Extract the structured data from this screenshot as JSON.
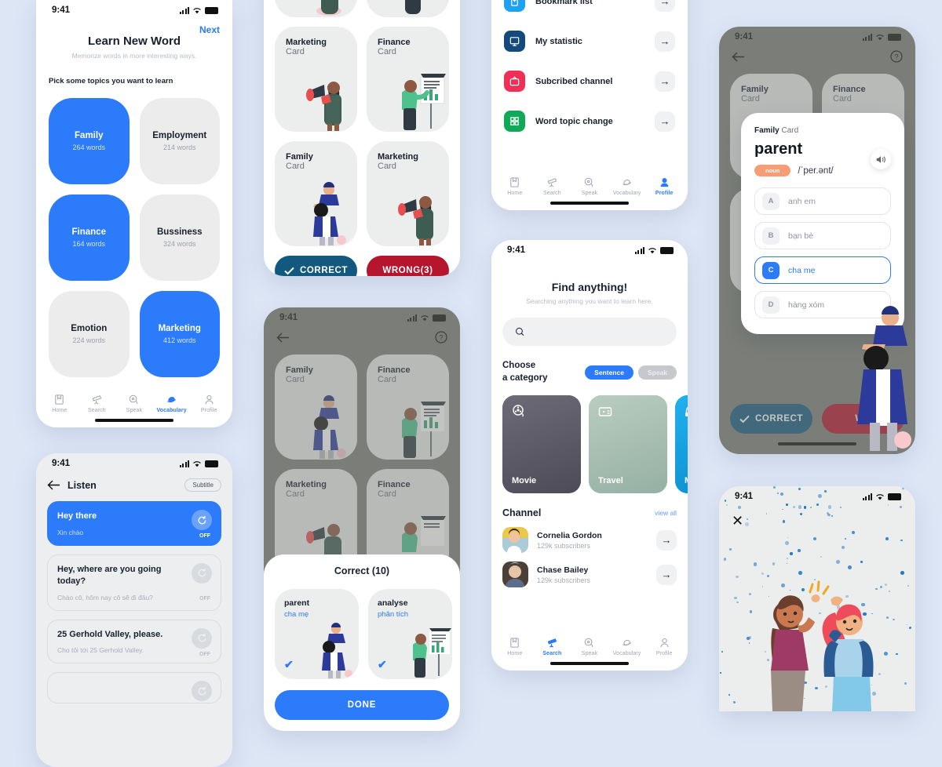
{
  "status_bar": {
    "time": "9:41"
  },
  "tabbar": {
    "items": [
      {
        "label": "Home",
        "icon": "home-book-icon"
      },
      {
        "label": "Search",
        "icon": "telescope-icon"
      },
      {
        "label": "Speak",
        "icon": "speak-bubble-icon"
      },
      {
        "label": "Vocabulary",
        "icon": "saturn-icon"
      },
      {
        "label": "Profile",
        "icon": "person-icon"
      }
    ]
  },
  "learn_screen": {
    "next_label": "Next",
    "title": "Learn New Word",
    "subtitle": "Memorize words in more interesting ways.",
    "pick_label": "Pick some topics you want to learn",
    "topics": [
      {
        "name": "Family",
        "words": "264 words",
        "selected": true
      },
      {
        "name": "Employment",
        "words": "214 words",
        "selected": false
      },
      {
        "name": "Finance",
        "words": "164 words",
        "selected": true
      },
      {
        "name": "Bussiness",
        "words": "324 words",
        "selected": false
      },
      {
        "name": "Emotion",
        "words": "224 words",
        "selected": false
      },
      {
        "name": "Marketing",
        "words": "412 words",
        "selected": true
      }
    ],
    "active_tab": "Vocabulary"
  },
  "listen_screen": {
    "title": "Listen",
    "subtitle_button": "Subtitle",
    "off_label": "OFF",
    "items": [
      {
        "en": "Hey there",
        "vi": "Xin chào",
        "active": true
      },
      {
        "en": "Hey, where are you going today?",
        "vi": "Chào cô, hôm nay cô sẽ đi đâu?",
        "active": false
      },
      {
        "en": "25 Gerhold Valley, please.",
        "vi": "Cho tôi tới 25 Gerhold Valley.",
        "active": false
      }
    ]
  },
  "flashcard_screen": {
    "cards": [
      {
        "topic": "Marketing",
        "sub": "Card",
        "art": "megaphone-woman"
      },
      {
        "topic": "Finance",
        "sub": "Card",
        "art": "chart-man"
      },
      {
        "topic": "Family",
        "sub": "Card",
        "art": "parent-child"
      },
      {
        "topic": "Marketing",
        "sub": "Card",
        "art": "megaphone-woman"
      }
    ],
    "correct_label": "CORRECT",
    "wrong_label": "WRONG(3)"
  },
  "correct_modal_screen": {
    "sheet_title": "Correct (10)",
    "results": [
      {
        "word": "parent",
        "translation": "cha mẹ",
        "art": "parent-child"
      },
      {
        "word": "analyse",
        "translation": "phân tích",
        "art": "chart-man"
      }
    ],
    "done_label": "DONE",
    "bg_cards": [
      {
        "topic": "Family",
        "sub": "Card",
        "art": "parent-child"
      },
      {
        "topic": "Finance",
        "sub": "Card",
        "art": "chart-man"
      },
      {
        "topic": "Marketing",
        "sub": "Card",
        "art": "megaphone-woman"
      },
      {
        "topic": "Finance",
        "sub": "Card",
        "art": "chart-man"
      }
    ]
  },
  "profile_menu_screen": {
    "items": [
      {
        "label": "Bookmark list",
        "icon": "bookmark-icon",
        "color": "#1da1f2"
      },
      {
        "label": "My statistic",
        "icon": "chart-icon",
        "color": "#134a7c"
      },
      {
        "label": "Subcribed channel",
        "icon": "tv-icon",
        "color": "#ef3054"
      },
      {
        "label": "Word topic change",
        "icon": "grid-icon",
        "color": "#0fa958"
      }
    ],
    "active_tab": "Profile"
  },
  "search_screen": {
    "title": "Find anything!",
    "subtitle": "Searching anything you want to learn here.",
    "search_placeholder": "",
    "choose_label_line1": "Choose",
    "choose_label_line2": "a category",
    "pills": [
      {
        "label": "Sentence",
        "active": true
      },
      {
        "label": "Speak",
        "active": false
      }
    ],
    "categories": [
      {
        "name": "Movie",
        "icon": "film-reel-icon",
        "color": "#5b5a66"
      },
      {
        "name": "Travel",
        "icon": "ticket-icon",
        "color": "#a6bfb0"
      },
      {
        "name": "Mu",
        "icon": "headphone-icon",
        "color": "#0b9fe3"
      }
    ],
    "channel_heading": "Channel",
    "view_all_label": "view all",
    "channels": [
      {
        "name": "Cornelia Gordon",
        "subs": "129k subscribers",
        "avatar": "woman-avatar"
      },
      {
        "name": "Chase Bailey",
        "subs": "129k subscribers",
        "avatar": "man-avatar"
      }
    ],
    "active_tab": "Search"
  },
  "word_quiz_screen": {
    "card_topic": "Family",
    "card_suffix": " Card",
    "word": "parent",
    "part_of_speech": "noun",
    "ipa": "/ˈper.ənt/",
    "options": [
      {
        "key": "A",
        "text": "anh em",
        "selected": false
      },
      {
        "key": "B",
        "text": "bạn bè",
        "selected": false
      },
      {
        "key": "C",
        "text": "cha mẹ",
        "selected": true
      },
      {
        "key": "D",
        "text": "hàng xóm",
        "selected": false
      }
    ],
    "correct_label": "CORRECT",
    "wrong_label": "WR",
    "bg_cards": [
      {
        "topic": "Family",
        "sub": "Card"
      },
      {
        "topic": "Finance",
        "sub": "Card"
      }
    ]
  },
  "congrats_screen": {
    "close_icon": "close-icon",
    "illustration": "high-five-people"
  },
  "colors": {
    "accent_blue": "#2b7bfb",
    "correct_blue": "#13597f",
    "wrong_red": "#b5152d",
    "badge_orange": "#f79d76",
    "background": "#dde6f5"
  }
}
